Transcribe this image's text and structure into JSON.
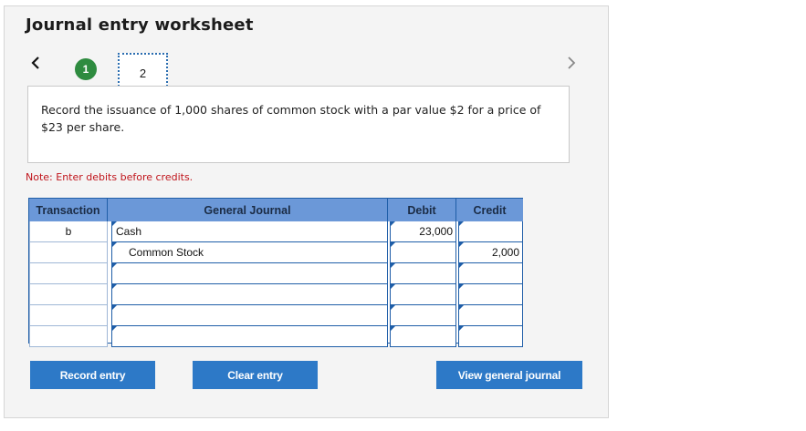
{
  "worksheet": {
    "title": "Journal entry worksheet",
    "steps": [
      "1",
      "2"
    ],
    "instruction": "Record the issuance of 1,000 shares of common stock with a par value $2 for a price of $23 per share.",
    "note": "Note: Enter debits before credits."
  },
  "table": {
    "headers": {
      "transaction": "Transaction",
      "general_journal": "General Journal",
      "debit": "Debit",
      "credit": "Credit"
    },
    "rows": [
      {
        "transaction": "b",
        "account": "Cash",
        "debit": "23,000",
        "credit": ""
      },
      {
        "transaction": "",
        "account": "Common Stock",
        "debit": "",
        "credit": "2,000"
      },
      {
        "transaction": "",
        "account": "",
        "debit": "",
        "credit": ""
      },
      {
        "transaction": "",
        "account": "",
        "debit": "",
        "credit": ""
      },
      {
        "transaction": "",
        "account": "",
        "debit": "",
        "credit": ""
      },
      {
        "transaction": "",
        "account": "",
        "debit": "",
        "credit": ""
      }
    ]
  },
  "buttons": {
    "record": "Record entry",
    "clear": "Clear entry",
    "view": "View general journal"
  },
  "icons": {
    "prev": "chevron-left-icon",
    "next": "chevron-right-icon"
  },
  "colors": {
    "accent": "#2d79c7",
    "header": "#6b98d8",
    "step_done": "#2e8b3f",
    "note": "#c0141b"
  }
}
